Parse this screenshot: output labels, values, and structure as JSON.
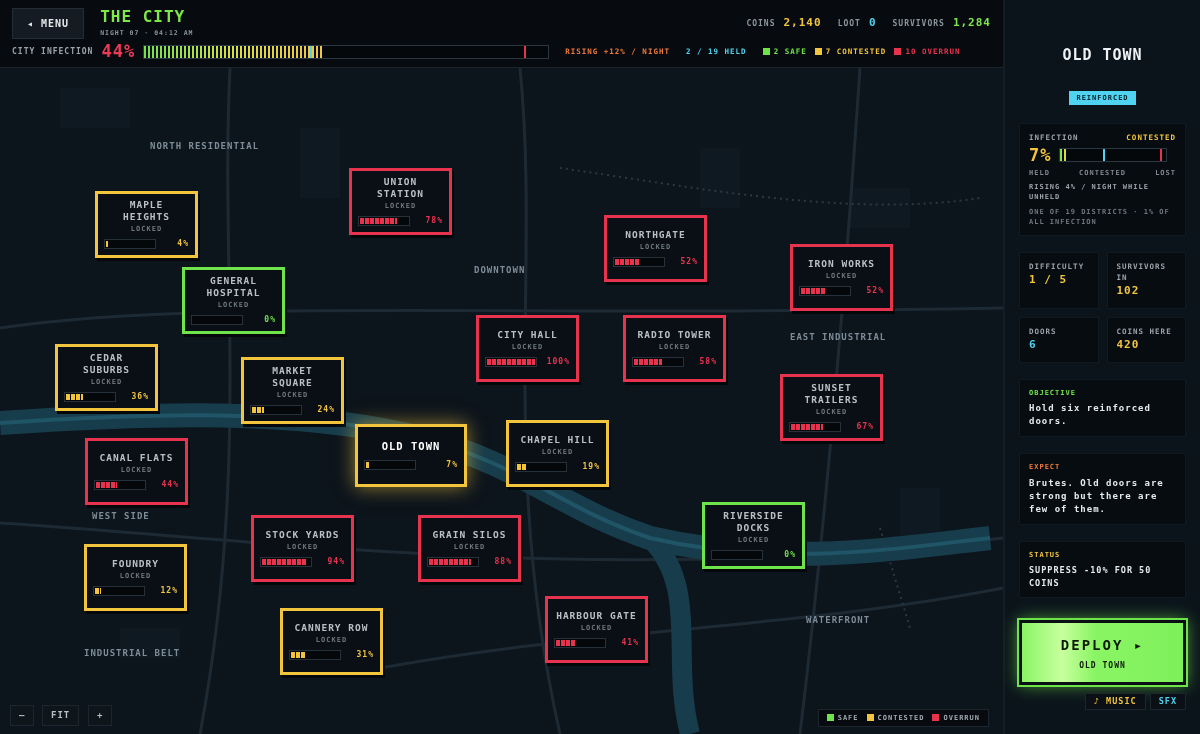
{
  "menu_button": "◂ MENU",
  "title": "THE CITY",
  "subtitle": "NIGHT 07 · 04:12 AM",
  "resources": [
    {
      "label": "COINS",
      "value": "2,140",
      "color": "#f2c53d"
    },
    {
      "label": "LOOT",
      "value": "0",
      "color": "#4fd3f0"
    },
    {
      "label": "SURVIVORS",
      "value": "1,284",
      "color": "#7ee84a"
    }
  ],
  "infection": {
    "label": "CITY INFECTION",
    "value": "44%",
    "level": 0.44,
    "trend": "RISING +12% / NIGHT",
    "held": "2 / 19 HELD"
  },
  "counts": [
    {
      "text": "2 SAFE",
      "color": "#6fe34a"
    },
    {
      "text": "7 CONTESTED",
      "color": "#f2c53d"
    },
    {
      "text": "10 OVERRUN",
      "color": "#e8334f"
    }
  ],
  "region_labels": [
    "NORTH RESIDENTIAL",
    "DOWNTOWN",
    "EAST INDUSTRIAL",
    "WEST SIDE",
    "WATERFRONT",
    "INDUSTRIAL BELT"
  ],
  "districts": [
    {
      "name": "MAPLE HEIGHTS",
      "color": "#f2c53d",
      "note": "LOCKED",
      "level": 0.04,
      "percent": "4%",
      "selected": false
    },
    {
      "name": "UNION STATION",
      "color": "#e8334f",
      "note": "LOCKED",
      "level": 0.78,
      "percent": "78%",
      "selected": false
    },
    {
      "name": "NORTHGATE",
      "color": "#e8334f",
      "note": "LOCKED",
      "level": 0.52,
      "percent": "52%",
      "selected": false
    },
    {
      "name": "IRON WORKS",
      "color": "#e8334f",
      "note": "LOCKED",
      "level": 0.52,
      "percent": "52%",
      "selected": false
    },
    {
      "name": "GENERAL HOSPITAL",
      "color": "#6fe34a",
      "note": "LOCKED",
      "level": 0,
      "percent": "0%",
      "selected": false
    },
    {
      "name": "CITY HALL",
      "color": "#e8334f",
      "note": "LOCKED",
      "level": 1,
      "percent": "100%",
      "selected": false
    },
    {
      "name": "RADIO TOWER",
      "color": "#e8334f",
      "note": "LOCKED",
      "level": 0.58,
      "percent": "58%",
      "selected": false
    },
    {
      "name": "CEDAR SUBURBS",
      "color": "#f2c53d",
      "note": "LOCKED",
      "level": 0.36,
      "percent": "36%",
      "selected": false
    },
    {
      "name": "MARKET SQUARE",
      "color": "#f2c53d",
      "note": "LOCKED",
      "level": 0.24,
      "percent": "24%",
      "selected": false
    },
    {
      "name": "SUNSET TRAILERS",
      "color": "#e8334f",
      "note": "LOCKED",
      "level": 0.67,
      "percent": "67%",
      "selected": false
    },
    {
      "name": "OLD TOWN",
      "color": "#f2c53d",
      "level": 0.07,
      "percent": "7%",
      "selected": true
    },
    {
      "name": "CHAPEL HILL",
      "color": "#f2c53d",
      "note": "LOCKED",
      "level": 0.19,
      "percent": "19%",
      "selected": false
    },
    {
      "name": "CANAL FLATS",
      "color": "#e8334f",
      "note": "LOCKED",
      "level": 0.44,
      "percent": "44%",
      "selected": false
    },
    {
      "name": "RIVERSIDE DOCKS",
      "color": "#6fe34a",
      "note": "LOCKED",
      "level": 0,
      "percent": "0%",
      "selected": false
    },
    {
      "name": "STOCK YARDS",
      "color": "#e8334f",
      "note": "LOCKED",
      "level": 0.94,
      "percent": "94%",
      "selected": false
    },
    {
      "name": "GRAIN SILOS",
      "color": "#e8334f",
      "note": "LOCKED",
      "level": 0.88,
      "percent": "88%",
      "selected": false
    },
    {
      "name": "FOUNDRY",
      "color": "#f2c53d",
      "note": "LOCKED",
      "level": 0.12,
      "percent": "12%",
      "selected": false
    },
    {
      "name": "HARBOUR GATE",
      "color": "#e8334f",
      "note": "LOCKED",
      "level": 0.41,
      "percent": "41%",
      "selected": false
    },
    {
      "name": "CANNERY ROW",
      "color": "#f2c53d",
      "note": "LOCKED",
      "level": 0.31,
      "percent": "31%",
      "selected": false
    }
  ],
  "map_controls": [
    "–",
    "FIT",
    "+"
  ],
  "map_legend": [
    {
      "text": "SAFE",
      "color": "#6fe34a"
    },
    {
      "text": "CONTESTED",
      "color": "#f2c53d"
    },
    {
      "text": "OVERRUN",
      "color": "#e8334f"
    }
  ],
  "panel": {
    "title": "OLD TOWN",
    "tag": "REINFORCED",
    "infection": {
      "label": "INFECTION",
      "state": "CONTESTED",
      "value": "7%",
      "level": 0.07,
      "scale": [
        "HELD",
        "CONTESTED",
        "LOST"
      ],
      "trend": "RISING 4% / NIGHT WHILE UNHELD",
      "share": "ONE OF 19 DISTRICTS · 1% OF ALL INFECTION"
    },
    "stats": [
      {
        "label": "DIFFICULTY",
        "value": "1 / 5",
        "color": "#f2c53d"
      },
      {
        "label": "SURVIVORS IN",
        "value": "102",
        "color": "#f2c53d"
      },
      {
        "label": "DOORS",
        "value": "6",
        "color": "#4fd3f0"
      },
      {
        "label": "COINS HERE",
        "value": "420",
        "color": "#f2c53d"
      }
    ],
    "notes": [
      {
        "heading": "OBJECTIVE",
        "text": "Hold six reinforced doors.",
        "color": "#6fe34a",
        "kind": "prose"
      },
      {
        "heading": "EXPECT",
        "text": "Brutes. Old doors are strong but there are few of them.",
        "color": "#f07a3a",
        "kind": "prose"
      },
      {
        "heading": "STATUS",
        "text": "SUPPRESS -10% FOR 50 COINS",
        "color": "#f2c53d",
        "kind": "caps"
      }
    ]
  },
  "deploy": {
    "label": "DEPLOY ▸",
    "target": "OLD TOWN"
  },
  "audio_buttons": [
    {
      "text": "♪ MUSIC",
      "color": "#f2c53d"
    },
    {
      "text": "SFX",
      "color": "#4fd3f0"
    }
  ]
}
